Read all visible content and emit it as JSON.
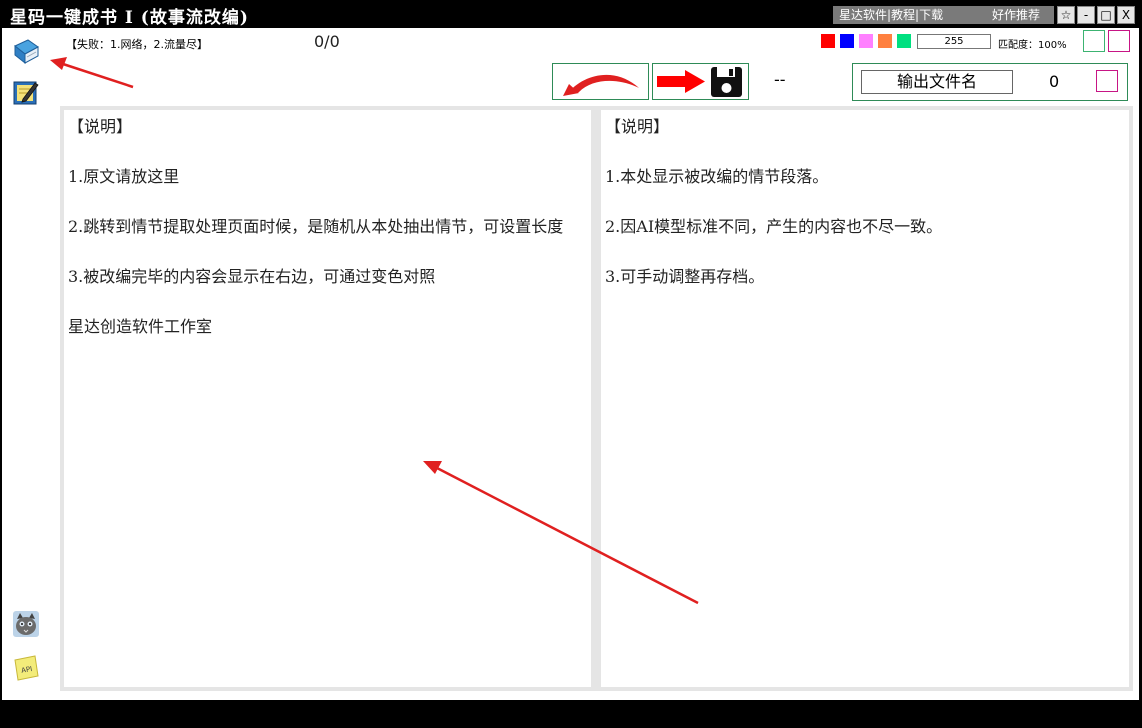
{
  "window": {
    "title": "星码一键成书 I (故事流改编)",
    "links": [
      "星达软件|教程|下载",
      "好作推荐"
    ],
    "buttons": {
      "pin": "☆",
      "minimize": "-",
      "maximize": "□",
      "close": "X"
    }
  },
  "sidebar": {
    "icons": [
      "book-icon",
      "notepad-edit-icon",
      "cat-avatar-icon",
      "api-note-icon"
    ]
  },
  "status": {
    "fail_text": "【失败：1.网络，2.流量尽】",
    "progress": "0/0"
  },
  "colors": {
    "swatches": [
      "#ff0000",
      "#0000ff",
      "#ff80ff",
      "#ff8040",
      "#00e080"
    ],
    "accent_border": "#2e8b57",
    "annotation_arrow": "#e02020"
  },
  "settings": {
    "value": "255",
    "match_label": "匹配度：100%"
  },
  "toolbar": {
    "undo_icon": "curved-arrow-left-icon",
    "save_icon": "save-to-disk-icon",
    "dash": "--",
    "output_file_label": "输出文件名",
    "output_count": "0"
  },
  "left_panel": {
    "lines": [
      "【说明】",
      "1.原文请放这里",
      "2.跳转到情节提取处理页面时候，是随机从本处抽出情节，可设置长度",
      "3.被改编完毕的内容会显示在右边，可通过变色对照",
      "星达创造软件工作室"
    ]
  },
  "right_panel": {
    "lines": [
      "【说明】",
      "1.本处显示被改编的情节段落。",
      "2.因AI模型标准不同，产生的内容也不尽一致。",
      "3.可手动调整再存档。"
    ]
  }
}
